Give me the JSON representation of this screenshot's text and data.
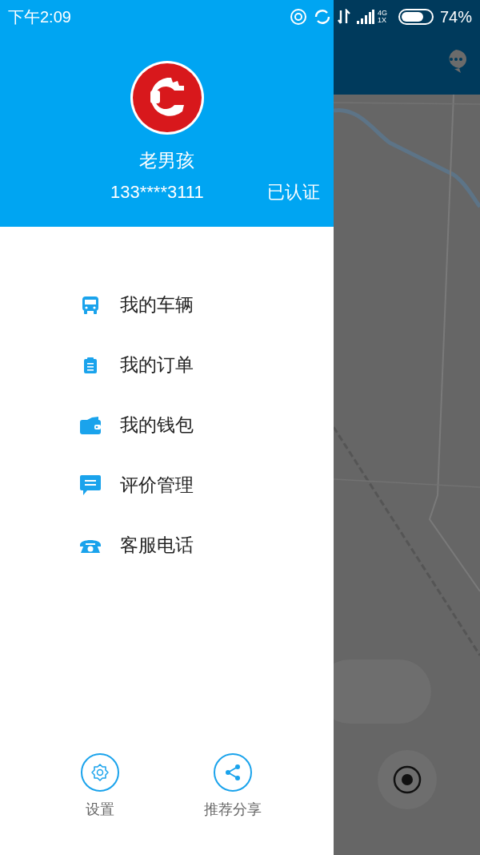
{
  "status_bar": {
    "time": "下午2:09",
    "network_top": "4G",
    "network_bottom": "1X",
    "battery_text": "74%"
  },
  "profile": {
    "name": "老男孩",
    "phone": "133****3111",
    "verified_label": "已认证"
  },
  "menu": [
    {
      "label": "我的车辆",
      "kind": "bus"
    },
    {
      "label": "我的订单",
      "kind": "clipboard"
    },
    {
      "label": "我的钱包",
      "kind": "wallet"
    },
    {
      "label": "评价管理",
      "kind": "comment"
    },
    {
      "label": "客服电话",
      "kind": "phone"
    }
  ],
  "footer": [
    {
      "label": "设置",
      "kind": "settings"
    },
    {
      "label": "推荐分享",
      "kind": "share"
    }
  ]
}
